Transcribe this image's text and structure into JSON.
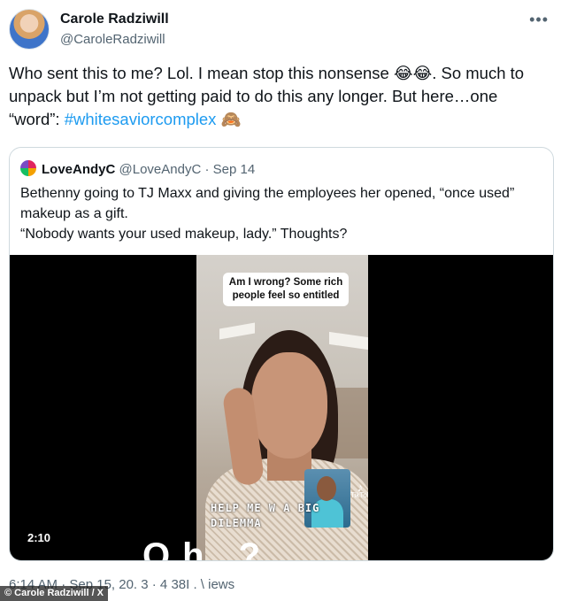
{
  "tweet": {
    "author_name": "Carole Radziwill",
    "author_handle": "@CaroleRadziwill",
    "more_icon": "more-icon",
    "text_before": "Who sent this to me? Lol. I mean stop this nonsense 😂😂. So much to unpack but I’m not getting paid to do this any longer. But here…one “word”: ",
    "hashtag": "#whitesaviorcomplex",
    "text_after": " 🙈",
    "footer": "6:14 AM · Sep 15, 20. 3 · 4 38I . \\ iews"
  },
  "quote": {
    "author_name": "LoveAndyC",
    "author_handle": "@LoveAndyC",
    "date_sep": " · ",
    "date": "Sep 14",
    "line1": "Bethenny going to TJ Maxx and giving the employees her opened, “once used” makeup as a gift.",
    "line2": "“Nobody wants your used makeup, lady.” Thoughts?"
  },
  "video": {
    "caption": "Am I wrong? Some rich people feel so entitled",
    "overlay_text": "HELP ME W A BIG DILEMMA",
    "watermark": "TikTok",
    "subtitle": "Oh  ?",
    "duration": "2:10"
  },
  "credit": "© Carole Radziwill / X"
}
